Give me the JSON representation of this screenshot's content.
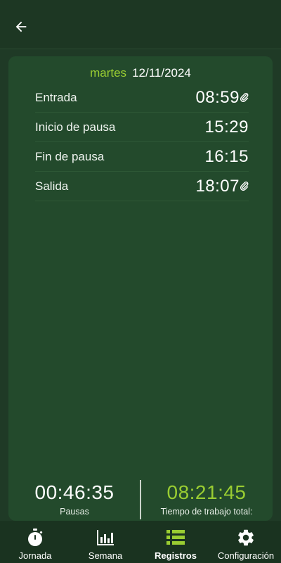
{
  "header": {
    "back_icon": "arrow-left-icon"
  },
  "record": {
    "day": "martes",
    "date": "12/11/2024",
    "entries": [
      {
        "label": "Entrada",
        "time": "08:59",
        "attachment": true
      },
      {
        "label": "Inicio de pausa",
        "time": "15:29",
        "attachment": false
      },
      {
        "label": "Fin de pausa",
        "time": "16:15",
        "attachment": false
      },
      {
        "label": "Salida",
        "time": "18:07",
        "attachment": true
      }
    ]
  },
  "totals": {
    "pauses_value": "00:46:35",
    "pauses_label": "Pausas",
    "work_value": "08:21:45",
    "work_label": "Tiempo de trabajo total:"
  },
  "nav": {
    "items": [
      {
        "label": "Jornada",
        "icon": "stopwatch-icon"
      },
      {
        "label": "Semana",
        "icon": "bar-chart-icon"
      },
      {
        "label": "Registros",
        "icon": "list-icon",
        "active": true
      },
      {
        "label": "Configuración",
        "icon": "gear-icon"
      }
    ]
  },
  "colors": {
    "accent": "#9acd32",
    "background": "#1f3a26",
    "card": "#234a2c"
  }
}
